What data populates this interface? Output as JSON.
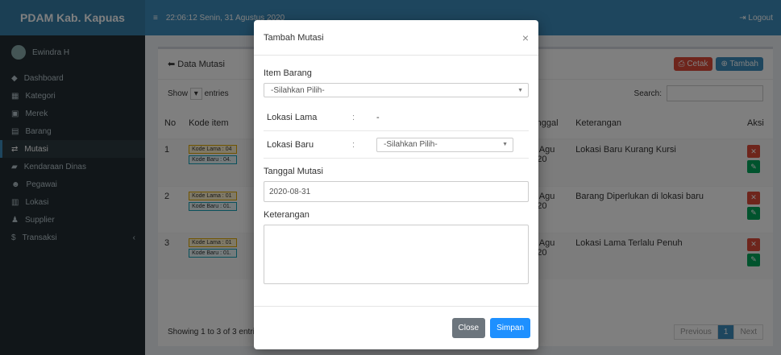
{
  "app": {
    "brand": "PDAM Kab. Kapuas",
    "user": "Ewindra H"
  },
  "topbar": {
    "datetime": "22:06:12 Senin, 31 Agustus 2020",
    "logout_label": "Logout",
    "logout_icon": "sign-out-icon"
  },
  "sidebar": {
    "items": [
      {
        "label": "Dashboard",
        "icon": "dashboard-icon"
      },
      {
        "label": "Kategori",
        "icon": "sitemap-icon"
      },
      {
        "label": "Merek",
        "icon": "image-icon"
      },
      {
        "label": "Barang",
        "icon": "cubes-icon"
      },
      {
        "label": "Mutasi",
        "icon": "exchange-icon"
      },
      {
        "label": "Kendaraan Dinas",
        "icon": "car-icon"
      },
      {
        "label": "Pegawai",
        "icon": "users-icon"
      },
      {
        "label": "Lokasi",
        "icon": "building-icon"
      },
      {
        "label": "Supplier",
        "icon": "user-tie-icon"
      },
      {
        "label": "Transaksi",
        "icon": "dollar-icon"
      }
    ]
  },
  "page": {
    "title": "Data Mutasi",
    "cetak_label": "Cetak",
    "tambah_label": "Tambah",
    "show_label": "Show",
    "entries_label": "entries",
    "search_label": "Search:",
    "columns": [
      "No",
      "Kode item",
      "Tanggal",
      "Keterangan",
      "Aksi"
    ],
    "rows": [
      {
        "no": "1",
        "lama": "Kode Lama : 04",
        "baru": "Kode Baru : 04.",
        "tanggal": "05 Agu 2020",
        "ket": "Lokasi Baru Kurang Kursi"
      },
      {
        "no": "2",
        "lama": "Kode Lama : 01",
        "baru": "Kode Baru : 01.",
        "tanggal": "12 Agu 2020",
        "ket": "Barang Diperlukan di lokasi baru"
      },
      {
        "no": "3",
        "lama": "Kode Lama : 01",
        "baru": "Kode Baru : 01.",
        "tanggal": "18 Agu 2020",
        "ket": "Lokasi Lama Terlalu Penuh"
      }
    ],
    "showing": "Showing 1 to 3 of 3 entries",
    "pager": {
      "previous": "Previous",
      "current": "1",
      "next": "Next"
    }
  },
  "modal": {
    "title": "Tambah Mutasi",
    "item_label": "Item Barang",
    "item_value": "-Silahkan Pilih-",
    "lokasi_lama_label": "Lokasi Lama",
    "lokasi_lama_value": "-",
    "lokasi_baru_label": "Lokasi Baru",
    "lokasi_baru_value": "-Silahkan Pilih-",
    "colon": ":",
    "tanggal_label": "Tanggal Mutasi",
    "tanggal_value": "2020-08-31",
    "keterangan_label": "Keterangan",
    "keterangan_value": "",
    "close_label": "Close",
    "simpan_label": "Simpan"
  }
}
